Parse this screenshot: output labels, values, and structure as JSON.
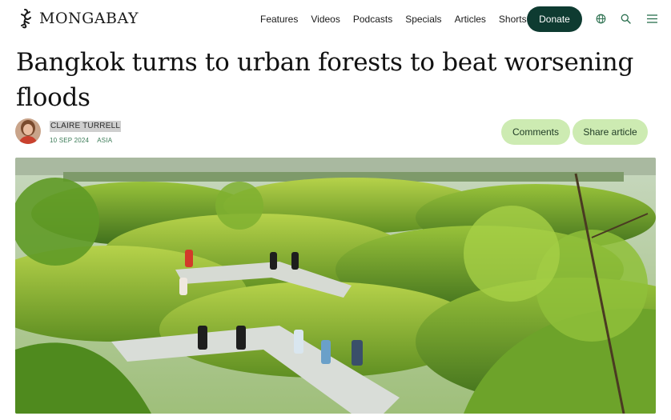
{
  "header": {
    "logo_text": "MONGABAY",
    "nav": [
      "Features",
      "Videos",
      "Podcasts",
      "Specials",
      "Articles",
      "Shorts"
    ],
    "donate_label": "Donate",
    "icons": [
      "language-icon",
      "search-icon",
      "menu-icon"
    ]
  },
  "article": {
    "title": "Bangkok turns to urban forests to beat worsening floods",
    "author": "CLAIRE TURRELL",
    "date": "10 SEP 2024",
    "section": "ASIA",
    "comments_label": "Comments",
    "share_label": "Share article"
  },
  "colors": {
    "donate_bg": "#0e3b31",
    "pill_bg": "#cdebb2",
    "meta_text": "#3a7a56"
  }
}
